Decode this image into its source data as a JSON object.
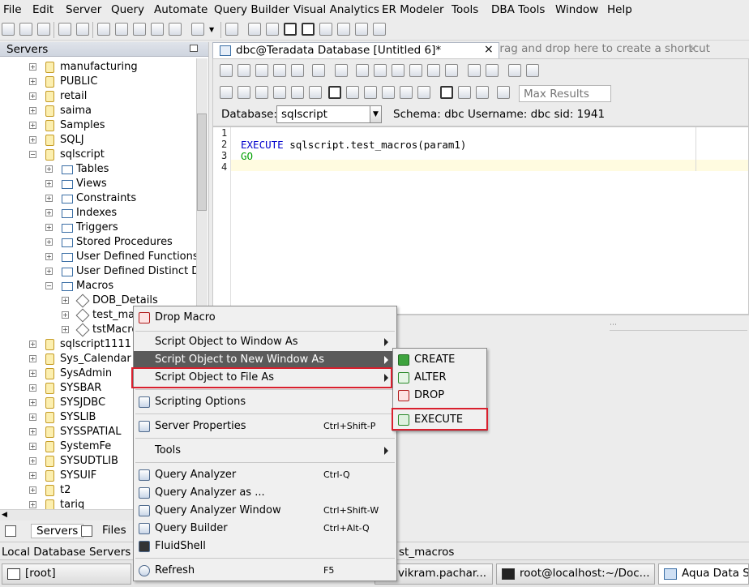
{
  "menubar": {
    "items": [
      "File",
      "Edit",
      "Server",
      "Query",
      "Automate",
      "Query Builder",
      "Visual Analytics",
      "ER Modeler",
      "Tools",
      "DBA Tools",
      "Window",
      "Help"
    ]
  },
  "toolbar": {
    "quick_access": "For quick access, drag and drop here to create a shortcut",
    "close_glyph": "×"
  },
  "servers": {
    "title": "Servers",
    "tree": [
      {
        "label": "manufacturing",
        "type": "db"
      },
      {
        "label": "PUBLIC",
        "type": "user"
      },
      {
        "label": "retail",
        "type": "db"
      },
      {
        "label": "saima",
        "type": "user"
      },
      {
        "label": "Samples",
        "type": "db"
      },
      {
        "label": "SQLJ",
        "type": "db"
      },
      {
        "label": "sqlscript",
        "type": "db"
      },
      {
        "label": "Tables",
        "type": "folder"
      },
      {
        "label": "Views",
        "type": "folder"
      },
      {
        "label": "Constraints",
        "type": "folder"
      },
      {
        "label": "Indexes",
        "type": "folder"
      },
      {
        "label": "Triggers",
        "type": "folder"
      },
      {
        "label": "Stored Procedures",
        "type": "folder"
      },
      {
        "label": "User Defined Functions",
        "type": "folder"
      },
      {
        "label": "User Defined Distinct Da",
        "type": "folder"
      },
      {
        "label": "Macros",
        "type": "folder"
      },
      {
        "label": "DOB_Details",
        "type": "macro"
      },
      {
        "label": "test_mac",
        "type": "macro"
      },
      {
        "label": "tstMacro",
        "type": "macro"
      },
      {
        "label": "sqlscript1111",
        "type": "db"
      },
      {
        "label": "Sys_Calendar",
        "type": "db"
      },
      {
        "label": "SysAdmin",
        "type": "user"
      },
      {
        "label": "SYSBAR",
        "type": "db"
      },
      {
        "label": "SYSJDBC",
        "type": "db"
      },
      {
        "label": "SYSLIB",
        "type": "db"
      },
      {
        "label": "SYSSPATIAL",
        "type": "db"
      },
      {
        "label": "SystemFe",
        "type": "user"
      },
      {
        "label": "SYSUDTLIB",
        "type": "db"
      },
      {
        "label": "SYSUIF",
        "type": "db"
      },
      {
        "label": "t2",
        "type": "db"
      },
      {
        "label": "tariq",
        "type": "db"
      }
    ]
  },
  "bottom_tabs": [
    "Servers",
    "Files"
  ],
  "editor": {
    "tab_title": "dbc@Teradata Database [Untitled 6]*",
    "max_results_placeholder": "Max Results",
    "database_label": "Database:",
    "database_value": "sqlscript",
    "schema_info": "Schema:  dbc     Username:  dbc     sid:  1941",
    "line_numbers": [
      "1",
      "2",
      "3",
      "4"
    ],
    "code": {
      "keyword": "EXECUTE",
      "call": " sqlscript.test_macros(param1)",
      "go": "GO"
    }
  },
  "context_menu": {
    "items": [
      {
        "label": "Drop Macro",
        "accel": "",
        "submenu": false
      },
      {
        "label": "Script Object to Window As",
        "accel": "",
        "submenu": true
      },
      {
        "label": "Script Object to New Window As",
        "accel": "",
        "submenu": true
      },
      {
        "label": "Script Object to File As",
        "accel": "",
        "submenu": true
      },
      {
        "label": "Scripting Options",
        "accel": "",
        "submenu": false
      },
      {
        "label": "Server Properties",
        "accel": "Ctrl+Shift-P",
        "submenu": false
      },
      {
        "label": "Tools",
        "accel": "",
        "submenu": true
      },
      {
        "label": "Query Analyzer",
        "accel": "Ctrl-Q",
        "submenu": false
      },
      {
        "label": "Query Analyzer as ...",
        "accel": "",
        "submenu": false
      },
      {
        "label": "Query Analyzer Window",
        "accel": "Ctrl+Shift-W",
        "submenu": false
      },
      {
        "label": "Query Builder",
        "accel": "Ctrl+Alt-Q",
        "submenu": false
      },
      {
        "label": "FluidShell",
        "accel": "",
        "submenu": false
      },
      {
        "label": "Refresh",
        "accel": "F5",
        "submenu": false
      }
    ],
    "submenu": [
      "CREATE",
      "ALTER",
      "DROP",
      "EXECUTE"
    ]
  },
  "status": {
    "left": "Local Database Servers / T",
    "right": "st_macros"
  },
  "taskbar": [
    "[root]",
    "vikram.pachar...",
    "root@localhost:~/Doc...",
    "Aqua Data S"
  ],
  "colors": {
    "highlight": "#5a5a5a",
    "annotation_red": "#d9202e",
    "keyword_blue": "#0000cc",
    "go_green": "#00a000"
  }
}
